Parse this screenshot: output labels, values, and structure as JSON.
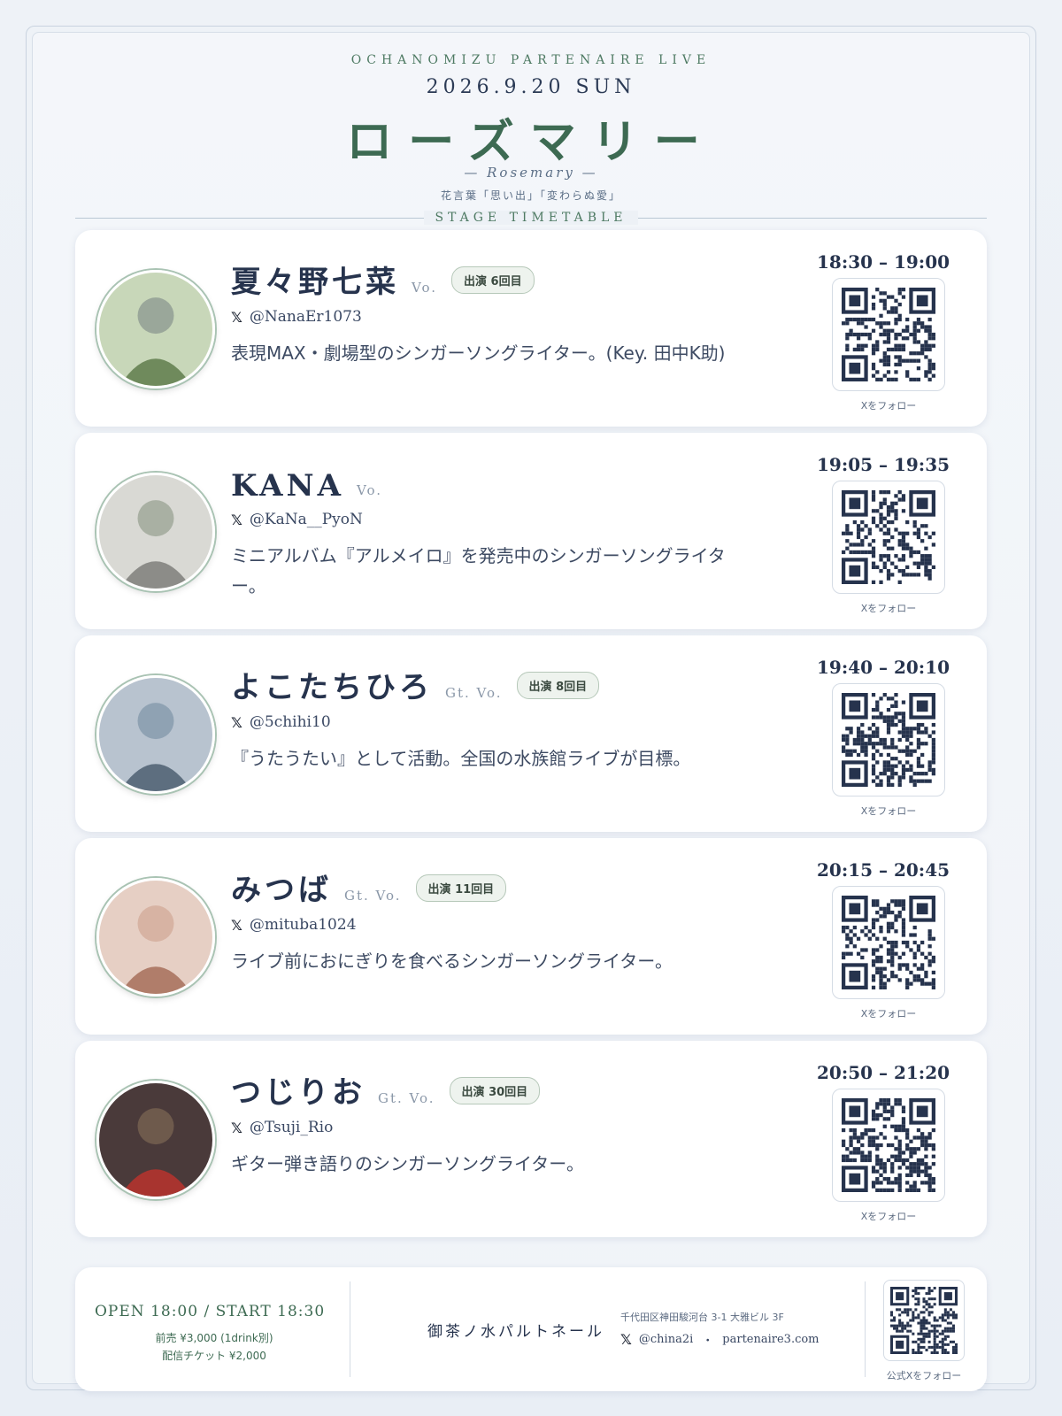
{
  "header": {
    "kicker": "OCHANOMIZU PARTENAIRE LIVE",
    "date": "2026.9.20 SUN",
    "title": "ローズマリー",
    "subtitle": "— Rosemary —",
    "flower_language": "花言葉「思い出」「変わらぬ愛」",
    "section": "STAGE TIMETABLE"
  },
  "colors": {
    "accent_green": "#3d6a52",
    "navy": "#26334d",
    "background": "#eef2f7"
  },
  "qr_label": "Xをフォロー",
  "performers": [
    {
      "name": "夏々野七菜",
      "role": "Vo.",
      "badge": "出演 6回目",
      "handle": "@NanaEr1073",
      "description": "表現MAX・劇場型のシンガーソングライター。(Key. 田中K助)",
      "time": "18:30 – 19:00"
    },
    {
      "name": "KANA",
      "role": "Vo.",
      "badge": "",
      "handle": "@KaNa__PyoN",
      "description": "ミニアルバム『アルメイロ』を発売中のシンガーソングライター。",
      "time": "19:05 – 19:35"
    },
    {
      "name": "よこたちひろ",
      "role": "Gt. Vo.",
      "badge": "出演 8回目",
      "handle": "@5chihi10",
      "description": "『うたうたい』として活動。全国の水族館ライブが目標。",
      "time": "19:40 – 20:10"
    },
    {
      "name": "みつば",
      "role": "Gt. Vo.",
      "badge": "出演 11回目",
      "handle": "@mituba1024",
      "description": "ライブ前におにぎりを食べるシンガーソングライター。",
      "time": "20:15 – 20:45"
    },
    {
      "name": "つじりお",
      "role": "Gt. Vo.",
      "badge": "出演 30回目",
      "handle": "@Tsuji_Rio",
      "description": "ギター弾き語りのシンガーソングライター。",
      "time": "20:50 – 21:20"
    }
  ],
  "footer": {
    "open_start": "OPEN 18:00 / START 18:30",
    "advance": "前売 ¥3,000 (1drink別)",
    "stream": "配信チケット ¥2,000",
    "venue": "御茶ノ水パルトネール",
    "address": "千代田区神田駿河台 3-1 大雅ビル 3F",
    "x_handle": "@china2i",
    "website": "partenaire3.com",
    "qr_label": "公式Xをフォロー"
  }
}
